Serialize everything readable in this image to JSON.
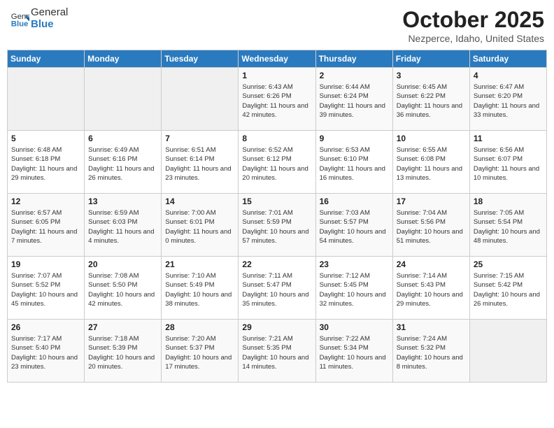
{
  "header": {
    "logo_general": "General",
    "logo_blue": "Blue",
    "month_title": "October 2025",
    "location": "Nezperce, Idaho, United States"
  },
  "weekdays": [
    "Sunday",
    "Monday",
    "Tuesday",
    "Wednesday",
    "Thursday",
    "Friday",
    "Saturday"
  ],
  "weeks": [
    [
      {
        "day": "",
        "sunrise": "",
        "sunset": "",
        "daylight": ""
      },
      {
        "day": "",
        "sunrise": "",
        "sunset": "",
        "daylight": ""
      },
      {
        "day": "",
        "sunrise": "",
        "sunset": "",
        "daylight": ""
      },
      {
        "day": "1",
        "sunrise": "Sunrise: 6:43 AM",
        "sunset": "Sunset: 6:26 PM",
        "daylight": "Daylight: 11 hours and 42 minutes."
      },
      {
        "day": "2",
        "sunrise": "Sunrise: 6:44 AM",
        "sunset": "Sunset: 6:24 PM",
        "daylight": "Daylight: 11 hours and 39 minutes."
      },
      {
        "day": "3",
        "sunrise": "Sunrise: 6:45 AM",
        "sunset": "Sunset: 6:22 PM",
        "daylight": "Daylight: 11 hours and 36 minutes."
      },
      {
        "day": "4",
        "sunrise": "Sunrise: 6:47 AM",
        "sunset": "Sunset: 6:20 PM",
        "daylight": "Daylight: 11 hours and 33 minutes."
      }
    ],
    [
      {
        "day": "5",
        "sunrise": "Sunrise: 6:48 AM",
        "sunset": "Sunset: 6:18 PM",
        "daylight": "Daylight: 11 hours and 29 minutes."
      },
      {
        "day": "6",
        "sunrise": "Sunrise: 6:49 AM",
        "sunset": "Sunset: 6:16 PM",
        "daylight": "Daylight: 11 hours and 26 minutes."
      },
      {
        "day": "7",
        "sunrise": "Sunrise: 6:51 AM",
        "sunset": "Sunset: 6:14 PM",
        "daylight": "Daylight: 11 hours and 23 minutes."
      },
      {
        "day": "8",
        "sunrise": "Sunrise: 6:52 AM",
        "sunset": "Sunset: 6:12 PM",
        "daylight": "Daylight: 11 hours and 20 minutes."
      },
      {
        "day": "9",
        "sunrise": "Sunrise: 6:53 AM",
        "sunset": "Sunset: 6:10 PM",
        "daylight": "Daylight: 11 hours and 16 minutes."
      },
      {
        "day": "10",
        "sunrise": "Sunrise: 6:55 AM",
        "sunset": "Sunset: 6:08 PM",
        "daylight": "Daylight: 11 hours and 13 minutes."
      },
      {
        "day": "11",
        "sunrise": "Sunrise: 6:56 AM",
        "sunset": "Sunset: 6:07 PM",
        "daylight": "Daylight: 11 hours and 10 minutes."
      }
    ],
    [
      {
        "day": "12",
        "sunrise": "Sunrise: 6:57 AM",
        "sunset": "Sunset: 6:05 PM",
        "daylight": "Daylight: 11 hours and 7 minutes."
      },
      {
        "day": "13",
        "sunrise": "Sunrise: 6:59 AM",
        "sunset": "Sunset: 6:03 PM",
        "daylight": "Daylight: 11 hours and 4 minutes."
      },
      {
        "day": "14",
        "sunrise": "Sunrise: 7:00 AM",
        "sunset": "Sunset: 6:01 PM",
        "daylight": "Daylight: 11 hours and 0 minutes."
      },
      {
        "day": "15",
        "sunrise": "Sunrise: 7:01 AM",
        "sunset": "Sunset: 5:59 PM",
        "daylight": "Daylight: 10 hours and 57 minutes."
      },
      {
        "day": "16",
        "sunrise": "Sunrise: 7:03 AM",
        "sunset": "Sunset: 5:57 PM",
        "daylight": "Daylight: 10 hours and 54 minutes."
      },
      {
        "day": "17",
        "sunrise": "Sunrise: 7:04 AM",
        "sunset": "Sunset: 5:56 PM",
        "daylight": "Daylight: 10 hours and 51 minutes."
      },
      {
        "day": "18",
        "sunrise": "Sunrise: 7:05 AM",
        "sunset": "Sunset: 5:54 PM",
        "daylight": "Daylight: 10 hours and 48 minutes."
      }
    ],
    [
      {
        "day": "19",
        "sunrise": "Sunrise: 7:07 AM",
        "sunset": "Sunset: 5:52 PM",
        "daylight": "Daylight: 10 hours and 45 minutes."
      },
      {
        "day": "20",
        "sunrise": "Sunrise: 7:08 AM",
        "sunset": "Sunset: 5:50 PM",
        "daylight": "Daylight: 10 hours and 42 minutes."
      },
      {
        "day": "21",
        "sunrise": "Sunrise: 7:10 AM",
        "sunset": "Sunset: 5:49 PM",
        "daylight": "Daylight: 10 hours and 38 minutes."
      },
      {
        "day": "22",
        "sunrise": "Sunrise: 7:11 AM",
        "sunset": "Sunset: 5:47 PM",
        "daylight": "Daylight: 10 hours and 35 minutes."
      },
      {
        "day": "23",
        "sunrise": "Sunrise: 7:12 AM",
        "sunset": "Sunset: 5:45 PM",
        "daylight": "Daylight: 10 hours and 32 minutes."
      },
      {
        "day": "24",
        "sunrise": "Sunrise: 7:14 AM",
        "sunset": "Sunset: 5:43 PM",
        "daylight": "Daylight: 10 hours and 29 minutes."
      },
      {
        "day": "25",
        "sunrise": "Sunrise: 7:15 AM",
        "sunset": "Sunset: 5:42 PM",
        "daylight": "Daylight: 10 hours and 26 minutes."
      }
    ],
    [
      {
        "day": "26",
        "sunrise": "Sunrise: 7:17 AM",
        "sunset": "Sunset: 5:40 PM",
        "daylight": "Daylight: 10 hours and 23 minutes."
      },
      {
        "day": "27",
        "sunrise": "Sunrise: 7:18 AM",
        "sunset": "Sunset: 5:39 PM",
        "daylight": "Daylight: 10 hours and 20 minutes."
      },
      {
        "day": "28",
        "sunrise": "Sunrise: 7:20 AM",
        "sunset": "Sunset: 5:37 PM",
        "daylight": "Daylight: 10 hours and 17 minutes."
      },
      {
        "day": "29",
        "sunrise": "Sunrise: 7:21 AM",
        "sunset": "Sunset: 5:35 PM",
        "daylight": "Daylight: 10 hours and 14 minutes."
      },
      {
        "day": "30",
        "sunrise": "Sunrise: 7:22 AM",
        "sunset": "Sunset: 5:34 PM",
        "daylight": "Daylight: 10 hours and 11 minutes."
      },
      {
        "day": "31",
        "sunrise": "Sunrise: 7:24 AM",
        "sunset": "Sunset: 5:32 PM",
        "daylight": "Daylight: 10 hours and 8 minutes."
      },
      {
        "day": "",
        "sunrise": "",
        "sunset": "",
        "daylight": ""
      }
    ]
  ]
}
